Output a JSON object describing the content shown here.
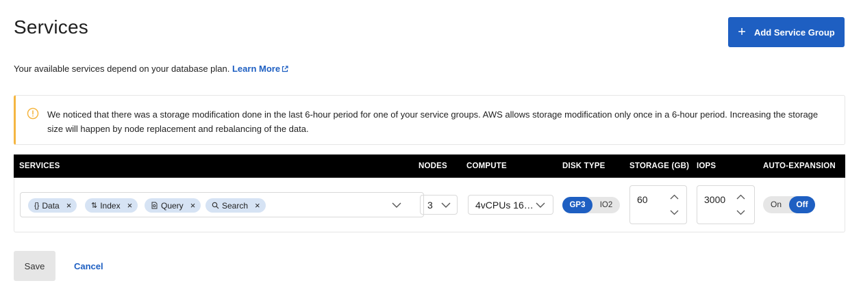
{
  "header": {
    "title": "Services",
    "add_button_label": "Add Service Group"
  },
  "description": {
    "text": "Your available services depend on your database plan.",
    "link_label": "Learn More"
  },
  "warning": {
    "text": "We noticed that there was a storage modification done in the last 6-hour period for one of your service groups. AWS allows storage modification only once in a 6-hour period. Increasing the storage size will happen by node replacement and rebalancing of the data."
  },
  "table": {
    "columns": {
      "services": "SERVICES",
      "nodes": "NODES",
      "compute": "COMPUTE",
      "disk_type": "DISK TYPE",
      "storage": "STORAGE (GB)",
      "iops": "IOPS",
      "auto_expansion": "AUTO-EXPANSION"
    },
    "row": {
      "services": [
        {
          "label": "Data",
          "icon": "braces-icon"
        },
        {
          "label": "Index",
          "icon": "sort-icon"
        },
        {
          "label": "Query",
          "icon": "document-search-icon"
        },
        {
          "label": "Search",
          "icon": "magnifier-icon"
        }
      ],
      "nodes": "3",
      "compute": "4vCPUs 16…",
      "disk_type": {
        "options": [
          "GP3",
          "IO2"
        ],
        "selected": "GP3"
      },
      "storage": "60",
      "iops": "3000",
      "auto_expansion": {
        "on_label": "On",
        "off_label": "Off",
        "selected": "Off"
      }
    }
  },
  "footer": {
    "save_label": "Save",
    "cancel_label": "Cancel"
  },
  "colors": {
    "primary": "#1e5fc2",
    "warning_accent": "#f5b642",
    "chip_bg": "#d6e3f4",
    "header_bg": "#000000"
  }
}
